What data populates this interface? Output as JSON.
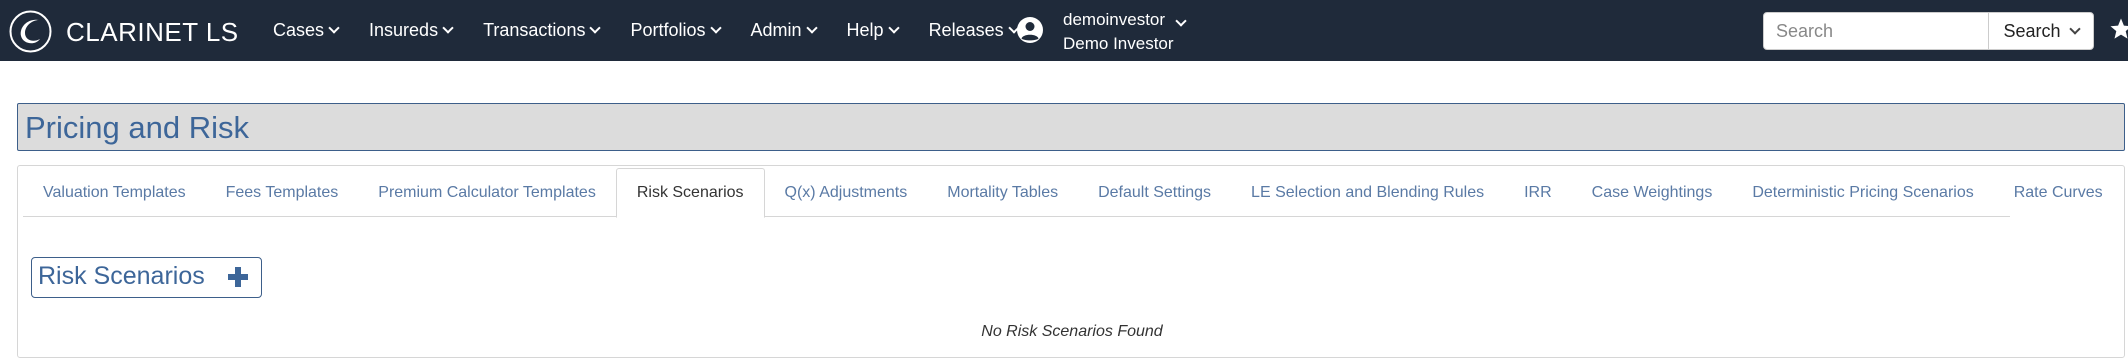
{
  "app": {
    "brand": "CLARINET LS"
  },
  "nav": {
    "items": [
      {
        "label": "Cases"
      },
      {
        "label": "Insureds"
      },
      {
        "label": "Transactions"
      },
      {
        "label": "Portfolios"
      },
      {
        "label": "Admin"
      },
      {
        "label": "Help"
      },
      {
        "label": "Releases"
      }
    ]
  },
  "user": {
    "username": "demoinvestor",
    "display_name": "Demo Investor"
  },
  "search": {
    "placeholder": "Search",
    "button_label": "Search"
  },
  "page": {
    "title": "Pricing and Risk"
  },
  "tabs": [
    {
      "label": "Valuation Templates",
      "active": false
    },
    {
      "label": "Fees Templates",
      "active": false
    },
    {
      "label": "Premium Calculator Templates",
      "active": false
    },
    {
      "label": "Risk Scenarios",
      "active": true
    },
    {
      "label": "Q(x) Adjustments",
      "active": false
    },
    {
      "label": "Mortality Tables",
      "active": false
    },
    {
      "label": "Default Settings",
      "active": false
    },
    {
      "label": "LE Selection and Blending Rules",
      "active": false
    },
    {
      "label": "IRR",
      "active": false
    },
    {
      "label": "Case Weightings",
      "active": false
    },
    {
      "label": "Deterministic Pricing Scenarios",
      "active": false
    },
    {
      "label": "Rate Curves",
      "active": false
    }
  ],
  "section": {
    "title": "Risk Scenarios",
    "empty_message": "No Risk Scenarios Found"
  },
  "colors": {
    "navbar": "#1f2a3a",
    "accent": "#3d6699",
    "tab_link": "#5a7aa5"
  }
}
